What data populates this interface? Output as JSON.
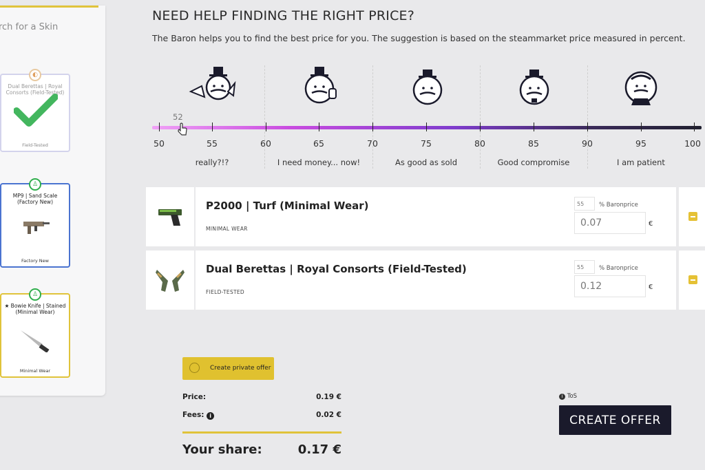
{
  "sidebar": {
    "search_placeholder": "arch for a Skin",
    "cards": [
      {
        "name": "Dual Berettas | Royal Consorts (Field-Tested)",
        "wear": "Field-Tested",
        "border": "#cfcfe6",
        "selected": true
      },
      {
        "name": "MP9 | Sand Scale (Factory New)",
        "wear": "Factory New",
        "border": "#4a73d0",
        "selected": false
      },
      {
        "name": "★ Bowie Knife | Stained (Minimal Wear)",
        "wear": "Minimal Wear",
        "border": "#e0c33a",
        "selected": false
      }
    ]
  },
  "header": {
    "title": "NEED HELP FINDING THE RIGHT PRICE?",
    "subtitle": "The Baron helps you to find the best price for you. The suggestion is based on the steammarket price measured in percent."
  },
  "slider": {
    "value": "52",
    "ticks": [
      "50",
      "55",
      "60",
      "65",
      "70",
      "75",
      "80",
      "85",
      "90",
      "95",
      "100"
    ],
    "zones": [
      "really?!?",
      "I need money... now!",
      "As good as sold",
      "Good compromise",
      "I am patient"
    ]
  },
  "items": [
    {
      "name": "P2000 | Turf (Minimal Wear)",
      "wear": "MINIMAL WEAR",
      "percent": "55",
      "percent_label": "% Baronprice",
      "price": "0.07",
      "currency": "€"
    },
    {
      "name": "Dual Berettas | Royal Consorts (Field-Tested)",
      "wear": "FIELD-TESTED",
      "percent": "55",
      "percent_label": "% Baronprice",
      "price": "0.12",
      "currency": "€"
    }
  ],
  "summary": {
    "private_offer_label": "Create private offer",
    "price_label": "Price:",
    "price_value": "0.19 €",
    "fees_label": "Fees:",
    "fees_value": "0.02 €",
    "share_label": "Your share:",
    "share_value": "0.17 €"
  },
  "actions": {
    "tos_label": "ToS",
    "create_offer_label": "CREATE OFFER"
  },
  "colors": {
    "accent": "#e0c33a",
    "dark_button": "#1a1a2b",
    "check": "#2fae4c"
  }
}
